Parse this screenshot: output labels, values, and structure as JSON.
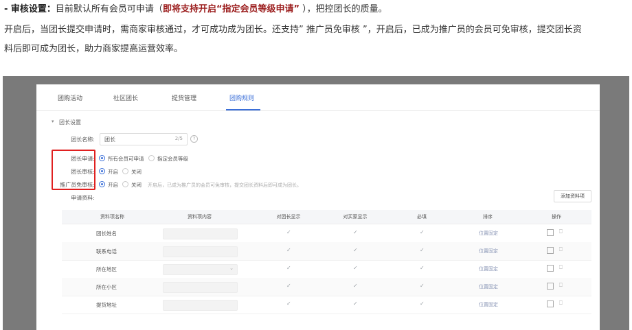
{
  "doc": {
    "line1": {
      "prefix": "- 审核设置：",
      "text_a": "目前默认所有会员可申请（",
      "highlight": "即将支持开启“指定会员等级申请”",
      "text_b": " ），把控团长的质量。"
    },
    "line2": "开启后，当团长提交申请时，需商家审核通过，才可成功成为团长。还支持” 推广员免审核 ”，开启后，已成为推广员的会员可免审核，提交团长资",
    "line3": "料后即可成为团长，助力商家提高运营效率。"
  },
  "screenshot": {
    "tabs": [
      {
        "label": "团购活动"
      },
      {
        "label": "社区团长"
      },
      {
        "label": "提货管理"
      },
      {
        "label": "团购规则"
      }
    ],
    "active_tab": "团购规则",
    "section": {
      "caret": "▾",
      "title": "团长设置"
    },
    "name_field": {
      "label": "团长名称:",
      "value": "团长",
      "count": "2/5",
      "help": "?"
    },
    "apply": {
      "label": "团长申请:",
      "options": [
        "所有会员可申请",
        "指定会员等级"
      ],
      "selected": "所有会员可申请"
    },
    "audit": {
      "label": "团长审核:",
      "options": [
        "开启",
        "关闭"
      ],
      "selected": "开启"
    },
    "promoter": {
      "label": "推广员免审核:",
      "options": [
        "开启",
        "关闭"
      ],
      "selected": "开启",
      "hint": "开启后，已成为推广员的会员可免审核，提交团长资料后即可成为团长。"
    },
    "apply_info": {
      "label": "申请资料:",
      "add_button": "添加资料项"
    },
    "table": {
      "headers": [
        "资料项名称",
        "资料项内容",
        "对团长显示",
        "对买家显示",
        "必填",
        "排序",
        "操作"
      ],
      "rows": [
        {
          "name": "团长姓名",
          "fixed": "位置固定",
          "has_dropdown": false
        },
        {
          "name": "联系电话",
          "fixed": "位置固定",
          "has_dropdown": false
        },
        {
          "name": "所在地区",
          "fixed": "位置固定",
          "has_dropdown": true
        },
        {
          "name": "所在小区",
          "fixed": "位置固定",
          "has_dropdown": false
        },
        {
          "name": "提货地址",
          "fixed": "位置固定",
          "has_dropdown": false
        }
      ],
      "check_glyph": "✓",
      "dropdown_glyph": "⌄",
      "edit_icon": "edit-icon",
      "delete_icon": "trash-icon"
    },
    "highlight_color": "#e02020",
    "accent_color": "#3b6fd8"
  }
}
